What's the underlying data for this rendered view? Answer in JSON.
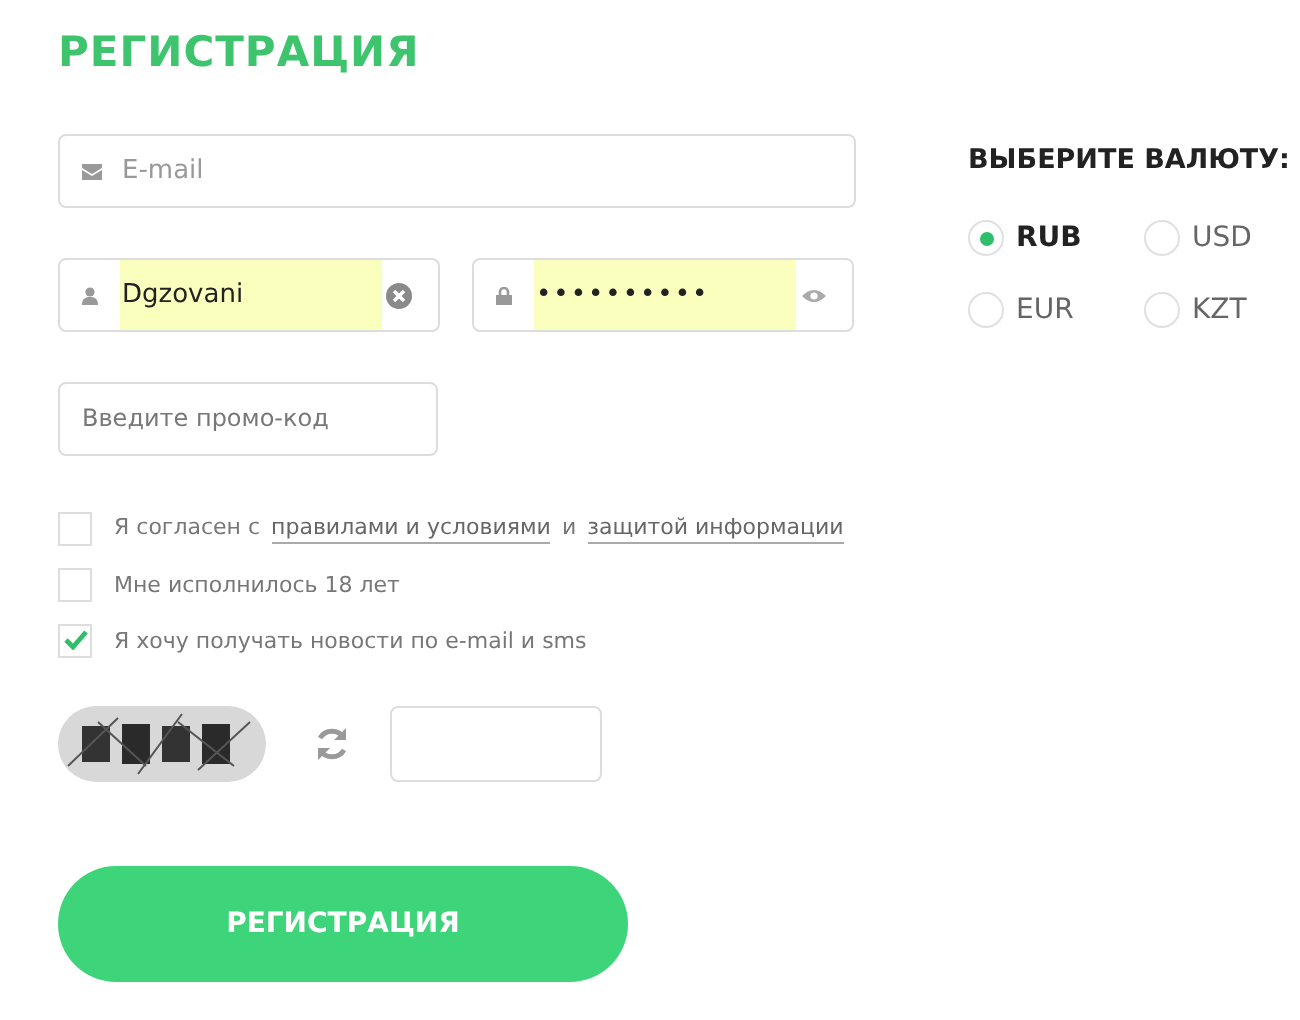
{
  "title": "РЕГИСТРАЦИЯ",
  "email": {
    "placeholder": "E-mail"
  },
  "username": {
    "value": "Dgzovani",
    "autofilled": true
  },
  "password": {
    "value": "••••••••••",
    "autofilled": true
  },
  "promo": {
    "placeholder": "Введите промо-код"
  },
  "agreements": [
    {
      "checked": false,
      "parts": [
        {
          "text": "Я согласен с",
          "link": false
        },
        {
          "text": "правилами и условиями",
          "link": true
        },
        {
          "text": "и",
          "link": false
        },
        {
          "text": "защитой информации",
          "link": true
        }
      ]
    },
    {
      "checked": false,
      "parts": [
        {
          "text": "Мне исполнилось 18 лет",
          "link": false
        }
      ]
    },
    {
      "checked": true,
      "parts": [
        {
          "text": "Я хочу получать новости по e-mail и sms",
          "link": false
        }
      ]
    }
  ],
  "submit": {
    "label": "РЕГИСТРАЦИЯ"
  },
  "currency": {
    "title": "ВЫБЕРИТЕ ВАЛЮТУ:",
    "options": [
      {
        "label": "RUB",
        "selected": true
      },
      {
        "label": "USD",
        "selected": false
      },
      {
        "label": "EUR",
        "selected": false
      },
      {
        "label": "KZT",
        "selected": false
      }
    ]
  }
}
